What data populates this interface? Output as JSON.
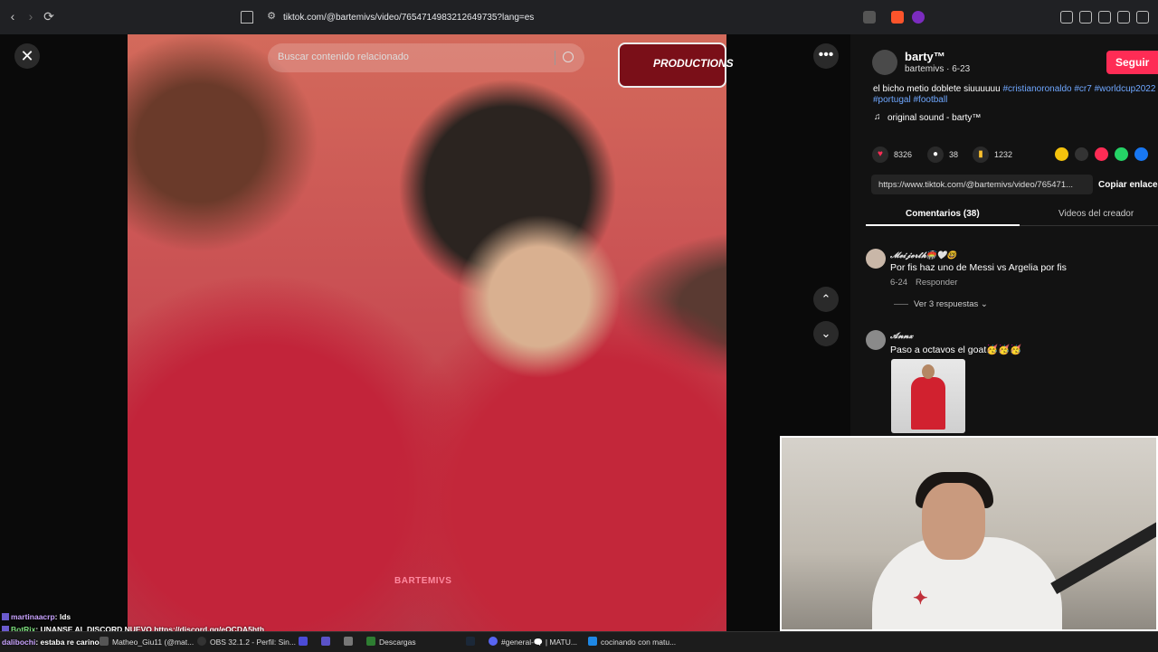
{
  "browser": {
    "url": "tiktok.com/@bartemivs/video/7654714983212649735?lang=es"
  },
  "video": {
    "search_placeholder": "Buscar contenido relacionado",
    "watermark": "BARTEMIVS",
    "logo_text": "PRODUCTIONS"
  },
  "post": {
    "author_name": "barty™",
    "author_meta": "bartemivs · 6-23",
    "follow_label": "Seguir",
    "desc_text": "el bicho metio doblete siuuuuuu ",
    "hashtags": "#cristianoronaldo #cr7 #worldcup2022",
    "hashtags2": "#portugal #football",
    "sound": "original sound - barty™",
    "likes": "8326",
    "comments": "38",
    "saves": "1232",
    "link": "https://www.tiktok.com/@bartemivs/video/765471...",
    "copy_label": "Copiar enlace"
  },
  "tabs": {
    "comments": "Comentarios (38)",
    "creator": "Videos del creador"
  },
  "comments": [
    {
      "name": "𝓜𝓮𝓲𝓳𝓮𝓻𝓽𝓱🏟️🤍🤓",
      "text": "Por fis haz uno de Messi vs Argelia por fis",
      "date": "6-24",
      "reply": "Responder",
      "replies": "Ver 3 respuestas ⌄"
    },
    {
      "name": "𝓐𝓷𝓷𝔁",
      "text": "Paso a octavos el goat🥳🥳🥳"
    }
  ],
  "chat": [
    {
      "user": "martinaacrp",
      "msg": ": lds"
    },
    {
      "user": "BotRix",
      "msg": ": UNANSE AL DISCORD NUEVO  https://discord.gg/eQCDA5hth"
    },
    {
      "user": "dalibochi",
      "msg": ": estaba re carinoso"
    }
  ],
  "taskbar": {
    "item1": "Matheo_Giu11 (@mat...",
    "item2": "OBS 32.1.2 - Perfil: Sin...",
    "item3": "Descargas",
    "item4": "#general-🗨️ | MATU...",
    "item5": "cocinando con matu..."
  },
  "colors": {
    "follow": "#fe2c55",
    "hashtag": "#6fa7ff",
    "panel_bg": "#121212"
  }
}
